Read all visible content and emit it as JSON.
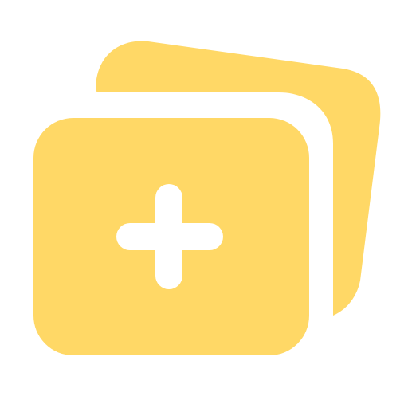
{
  "icon": {
    "name": "add-card-icon",
    "color": "#FFD866",
    "symbol_color": "#FFFFFF",
    "background": "#FFFFFF"
  }
}
